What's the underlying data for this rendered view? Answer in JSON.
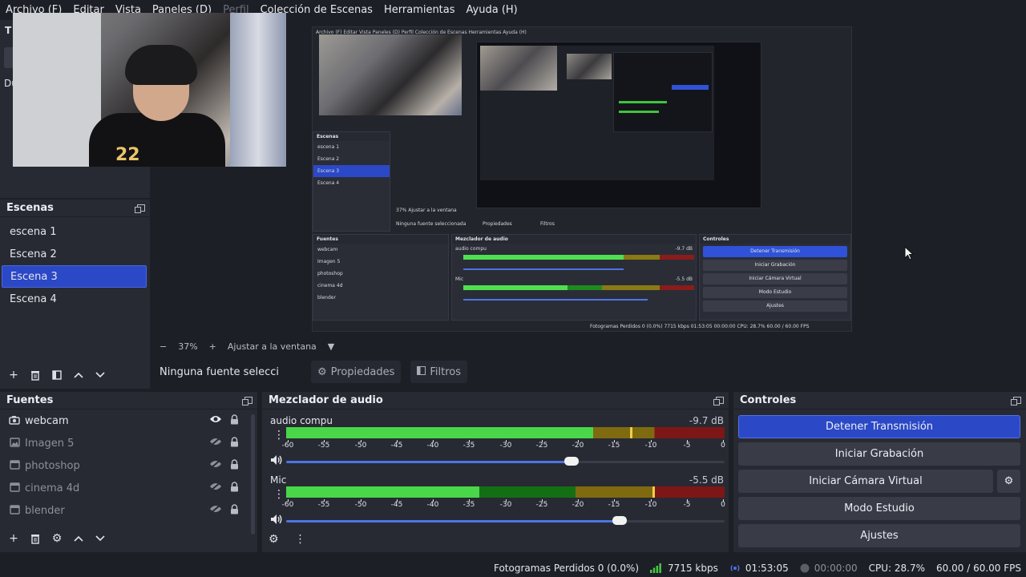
{
  "menu": [
    "Archivo (F)",
    "Editar",
    "Vista",
    "Paneles (D)",
    "Perfil",
    "Colección de Escenas",
    "Herramientas",
    "Ayuda (H)"
  ],
  "left_top": {
    "tab_letter": "T",
    "du_label": "Du"
  },
  "preview_bar": {
    "zoom_minus": "−",
    "zoom": "37%",
    "zoom_plus": "+",
    "fit": "Ajustar a la ventana",
    "fit_arrow": "▼"
  },
  "scenes": {
    "title": "Escenas",
    "items": [
      "escena 1",
      "Escena 2",
      "Escena 3",
      "Escena 4"
    ],
    "selected_index": 2
  },
  "source_bar": {
    "no_source": "Ninguna fuente seleccionada",
    "properties": "Propiedades",
    "filters": "Filtros"
  },
  "sources": {
    "title": "Fuentes",
    "items": [
      {
        "name": "webcam",
        "icon": "camera-icon",
        "visible": true
      },
      {
        "name": "Imagen 5",
        "icon": "image-icon",
        "visible": false
      },
      {
        "name": "photoshop",
        "icon": "window-icon",
        "visible": false
      },
      {
        "name": "cinema 4d",
        "icon": "window-icon",
        "visible": false
      },
      {
        "name": "blender",
        "icon": "window-icon",
        "visible": false
      }
    ]
  },
  "mixer": {
    "title": "Mezclador de audio",
    "channels": [
      {
        "name": "audio compu",
        "db": "-9.7 dB",
        "level": 0.7,
        "peak": 0.785,
        "volume": 0.65
      },
      {
        "name": "Mic",
        "db": "-5.5 dB",
        "level": 0.44,
        "peak": 0.835,
        "volume": 0.76
      }
    ],
    "ticks": [
      "-60",
      "-55",
      "-50",
      "-45",
      "-40",
      "-35",
      "-30",
      "-25",
      "-20",
      "-15",
      "-10",
      "-5",
      "0"
    ]
  },
  "controls": {
    "title": "Controles",
    "stop_stream": "Detener Transmisión",
    "start_recording": "Iniciar Grabación",
    "virtual_camera": "Iniciar Cámara Virtual",
    "studio_mode": "Modo Estudio",
    "settings": "Ajustes"
  },
  "status": {
    "dropped": "Fotogramas Perdidos 0 (0.0%)",
    "bitrate": "7715 kbps",
    "stream_time": "01:53:05",
    "rec_time": "00:00:00",
    "cpu": "CPU: 28.7%",
    "fps": "60.00 / 60.00 FPS"
  },
  "nested": {
    "menu": "Archivo (F)   Editar   Vista   Paneles (D)   Perfil   Colección de Escenas   Herramientas   Ayuda (H)",
    "scenes_title": "Escenas",
    "scenes": [
      "escena 1",
      "Escena 2",
      "Escena 3",
      "Escena 4"
    ],
    "zoom": "37%   Ajustar a la ventana",
    "no_source": "Ninguna fuente seleccionada",
    "properties": "Propiedades",
    "filters": "Filtros",
    "sources_title": "Fuentes",
    "sources": [
      "webcam",
      "Imagen 5",
      "photoshop",
      "cinema 4d",
      "blender"
    ],
    "mixer_title": "Mezclador de audio",
    "chan1": "audio compu",
    "chan1_db": "-9.7 dB",
    "chan2": "Mic",
    "chan2_db": "-5.5 dB",
    "controls_title": "Controles",
    "buttons": [
      "Detener Transmisión",
      "Iniciar Grabación",
      "Iniciar Cámara Virtual",
      "Modo Estudio",
      "Ajustes"
    ],
    "status": "Fotogramas Perdidos 0 (0.0%)   7715 kbps   01:53:05   00:00:00   CPU: 28.7%   60.00 / 60.00 FPS"
  },
  "colors": {
    "accent": "#2b48c6",
    "meter_green": "#49d749",
    "meter_yellow": "#d3b418",
    "meter_red": "#7d1717"
  }
}
